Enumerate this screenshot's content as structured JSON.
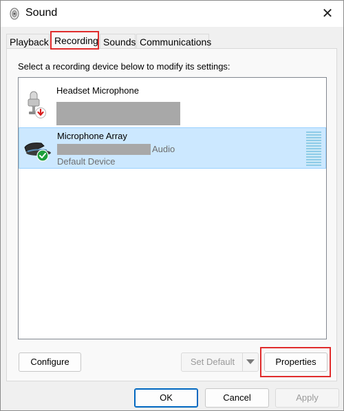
{
  "window": {
    "title": "Sound",
    "close_glyph": "✕"
  },
  "tabs": [
    {
      "label": "Playback"
    },
    {
      "label": "Recording"
    },
    {
      "label": "Sounds"
    },
    {
      "label": "Communications"
    }
  ],
  "active_tab": "Recording",
  "instruction": "Select a recording device below to modify its settings:",
  "devices": [
    {
      "name": "Headset Microphone",
      "status_icon": "red-down-arrow-icon",
      "selected": false
    },
    {
      "name": "Microphone Array",
      "suffix": "Audio",
      "status": "Default Device",
      "status_icon": "green-check-icon",
      "selected": true
    }
  ],
  "buttons": {
    "configure": "Configure",
    "set_default": "Set Default",
    "properties": "Properties",
    "ok": "OK",
    "cancel": "Cancel",
    "apply": "Apply"
  },
  "colors": {
    "selection": "#cce8ff",
    "highlight": "#e02b2b",
    "accent": "#0067c0"
  }
}
